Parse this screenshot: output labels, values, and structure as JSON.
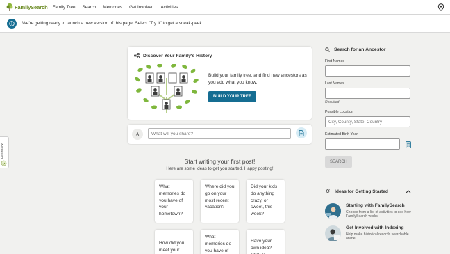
{
  "header": {
    "logo_text": "FamilySearch",
    "nav": [
      "Family Tree",
      "Search",
      "Memories",
      "Get Involved",
      "Activities"
    ],
    "location_icon": "map-pin-icon"
  },
  "banner": {
    "icon": "info-icon",
    "text": "We're getting ready to launch a new version of this page. Select \"Try It\" to get a sneak-peek."
  },
  "discover": {
    "icon": "share-nodes-icon",
    "title": "Discover Your Family's History",
    "body": "Build your family tree, and find new ancestors as you add what you know.",
    "button": "BUILD YOUR TREE"
  },
  "share": {
    "avatar_letter": "A",
    "placeholder": "What will you share?",
    "post_icon": "document-icon"
  },
  "start": {
    "title": "Start writing your first post!",
    "subtitle": "Here are some ideas to get you started. Happy posting!"
  },
  "ideas": [
    "What memories do you have of your hometown?",
    "Where did you go on your most recent vacation?",
    "Did your kids do anything crazy, or sweet, this week?",
    "How did you meet your",
    "What memories do you have of",
    "Have your own idea? Click to"
  ],
  "feedback": {
    "label": "Feedback"
  },
  "search": {
    "icon": "search-icon",
    "title": "Search for an Ancestor",
    "first_name_label": "First Names",
    "last_name_label": "Last Names",
    "required": "Required",
    "location_label": "Possible Location",
    "location_placeholder": "City, County, State, Country",
    "birth_year_label": "Estimated Birth Year",
    "calculator_icon": "calculator-icon",
    "button": "SEARCH"
  },
  "getting_started": {
    "icon": "lightbulb-icon",
    "title": "Ideas for Getting Started",
    "collapse_icon": "chevron-up-icon",
    "items": [
      {
        "title": "Starting with FamilySearch",
        "desc": "Choose from a list of activities to see how FamilySearch works."
      },
      {
        "title": "Get Involved with Indexing",
        "desc": "Help make historical records searchable online."
      }
    ]
  },
  "colors": {
    "primary": "#156d92",
    "logo_green": "#6a8a22",
    "background": "#f1f1ef"
  }
}
